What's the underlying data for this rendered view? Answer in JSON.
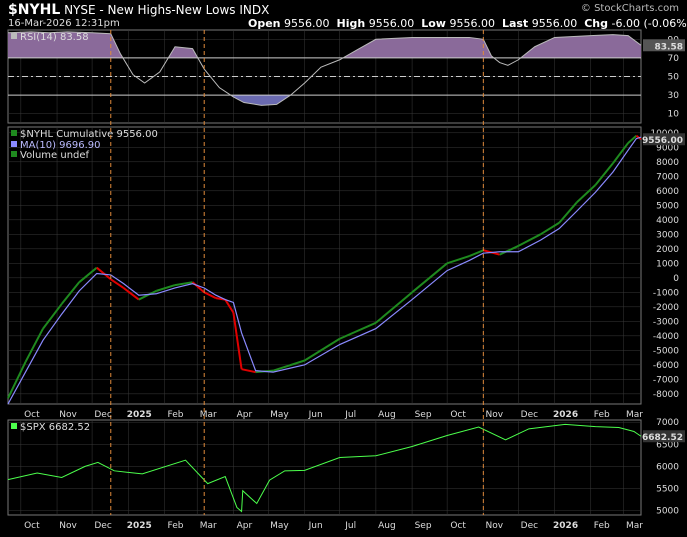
{
  "header": {
    "symbol": "$NYHL",
    "name": "NYSE - New Highs-New Lows",
    "exchange": "INDX",
    "date": "16-Mar-2026 12:31pm",
    "open_label": "Open",
    "open": "9556.00",
    "high_label": "High",
    "high": "9556.00",
    "low_label": "Low",
    "low": "9556.00",
    "last_label": "Last",
    "last": "9556.00",
    "chg_label": "Chg",
    "chg": "-6.00 (-0.06%)",
    "brand": "© StockCharts.com"
  },
  "colors": {
    "background": "#000000",
    "grid": "#3a3a3a",
    "up": "#1f8a1f",
    "down": "#e00000",
    "ma": "#8a8aff",
    "rsi_fill_high": "#8a6a9a",
    "rsi_fill_low": "#6a6ab0",
    "spx": "#4cff4c",
    "marker": "#e08a3a"
  },
  "chart_data": [
    {
      "type": "area",
      "panel": "rsi",
      "legend": "RSI(14) 83.58",
      "last_value_badge": "83.58",
      "ylim": [
        0,
        100
      ],
      "yticks": [
        10,
        30,
        50,
        70,
        90
      ],
      "ref_lines": [
        30,
        50,
        70
      ],
      "x": [
        "2024-09-20",
        "2024-10-10",
        "2024-10-25",
        "2024-11-10",
        "2024-12-01",
        "2024-12-17",
        "2024-12-25",
        "2025-01-05",
        "2025-01-15",
        "2025-01-28",
        "2025-02-10",
        "2025-02-25",
        "2025-03-07",
        "2025-03-20",
        "2025-04-01",
        "2025-04-10",
        "2025-04-25",
        "2025-05-08",
        "2025-05-20",
        "2025-06-01",
        "2025-06-15",
        "2025-07-01",
        "2025-07-15",
        "2025-08-01",
        "2025-09-01",
        "2025-10-01",
        "2025-10-20",
        "2025-11-01",
        "2025-11-08",
        "2025-11-15",
        "2025-11-22",
        "2025-12-01",
        "2025-12-15",
        "2026-01-01",
        "2026-02-01",
        "2026-02-20",
        "2026-03-05",
        "2026-03-16"
      ],
      "values": [
        97,
        98,
        97,
        98,
        97,
        96,
        75,
        52,
        43,
        55,
        82,
        80,
        58,
        38,
        28,
        22,
        19,
        20,
        30,
        43,
        60,
        68,
        78,
        90,
        92,
        92,
        92,
        90,
        72,
        65,
        62,
        68,
        82,
        92,
        94,
        95,
        94,
        83.58
      ]
    },
    {
      "type": "line",
      "panel": "main",
      "legend": [
        "$NYHL Cumulative 9556.00",
        "MA(10) 9696.90",
        "Volume undef"
      ],
      "last_value_badge": "9556.00",
      "ylim": [
        -8700,
        10400
      ],
      "yticks": [
        -8000,
        -7000,
        -6000,
        -5000,
        -4000,
        -3000,
        -2000,
        -1000,
        0,
        1000,
        2000,
        3000,
        4000,
        5000,
        6000,
        7000,
        8000,
        9000,
        10000
      ],
      "xticks": [
        "Oct",
        "Nov",
        "Dec",
        "2025",
        "Feb",
        "Mar",
        "Apr",
        "May",
        "Jun",
        "Jul",
        "Aug",
        "Sep",
        "Oct",
        "Nov",
        "Dec",
        "2026",
        "Feb",
        "Mar"
      ],
      "markers": [
        "2024-12-17",
        "2025-03-07",
        "2025-11-01"
      ],
      "series": [
        {
          "name": "$NYHL Cumulative",
          "x": [
            "2024-09-20",
            "2024-10-05",
            "2024-10-20",
            "2024-11-05",
            "2024-11-20",
            "2024-12-05",
            "2024-12-17",
            "2024-12-28",
            "2025-01-10",
            "2025-01-25",
            "2025-02-10",
            "2025-02-25",
            "2025-03-07",
            "2025-03-17",
            "2025-03-25",
            "2025-04-01",
            "2025-04-08",
            "2025-04-20",
            "2025-05-05",
            "2025-06-01",
            "2025-07-01",
            "2025-08-01",
            "2025-09-01",
            "2025-10-01",
            "2025-10-20",
            "2025-11-01",
            "2025-11-15",
            "2025-12-01",
            "2025-12-20",
            "2026-01-05",
            "2026-01-20",
            "2026-02-05",
            "2026-02-20",
            "2026-03-05",
            "2026-03-12",
            "2026-03-16"
          ],
          "values": [
            -8300,
            -5800,
            -3500,
            -1800,
            -300,
            700,
            -100,
            -700,
            -1500,
            -900,
            -500,
            -300,
            -1000,
            -1400,
            -1500,
            -2400,
            -6300,
            -6500,
            -6400,
            -5700,
            -4200,
            -3100,
            -1000,
            1000,
            1500,
            1900,
            1600,
            2200,
            3000,
            3800,
            5200,
            6400,
            7900,
            9300,
            9800,
            9556
          ]
        },
        {
          "name": "MA(10)",
          "x": [
            "2024-09-20",
            "2024-10-05",
            "2024-10-20",
            "2024-11-05",
            "2024-11-20",
            "2024-12-05",
            "2024-12-17",
            "2024-12-28",
            "2025-01-10",
            "2025-01-25",
            "2025-02-10",
            "2025-02-25",
            "2025-03-07",
            "2025-03-17",
            "2025-03-25",
            "2025-04-01",
            "2025-04-08",
            "2025-04-20",
            "2025-05-05",
            "2025-06-01",
            "2025-07-01",
            "2025-08-01",
            "2025-09-01",
            "2025-10-01",
            "2025-10-20",
            "2025-11-01",
            "2025-11-15",
            "2025-12-01",
            "2025-12-20",
            "2026-01-05",
            "2026-01-20",
            "2026-02-05",
            "2026-02-20",
            "2026-03-05",
            "2026-03-12",
            "2026-03-16"
          ],
          "values": [
            -8700,
            -6500,
            -4300,
            -2500,
            -900,
            300,
            200,
            -400,
            -1200,
            -1100,
            -700,
            -400,
            -700,
            -1200,
            -1500,
            -1700,
            -3800,
            -6400,
            -6500,
            -6000,
            -4600,
            -3500,
            -1500,
            500,
            1200,
            1700,
            1800,
            1800,
            2600,
            3400,
            4600,
            5900,
            7300,
            8800,
            9600,
            9697
          ]
        }
      ]
    },
    {
      "type": "line",
      "panel": "spx",
      "legend": "$SPX 6682.52",
      "last_value_badge": "6682.52",
      "ylim": [
        4900,
        7050
      ],
      "yticks": [
        5000,
        5500,
        6000,
        6500,
        7000
      ],
      "xticks": [
        "Oct",
        "Nov",
        "Dec",
        "2025",
        "Feb",
        "Mar",
        "Apr",
        "May",
        "Jun",
        "Jul",
        "Aug",
        "Sep",
        "Oct",
        "Nov",
        "Dec",
        "2026",
        "Feb",
        "Mar"
      ],
      "series": [
        {
          "name": "$SPX",
          "x": [
            "2024-09-20",
            "2024-10-15",
            "2024-11-05",
            "2024-11-25",
            "2024-12-06",
            "2024-12-20",
            "2025-01-13",
            "2025-02-19",
            "2025-03-10",
            "2025-03-25",
            "2025-04-04",
            "2025-04-08",
            "2025-04-09",
            "2025-04-21",
            "2025-05-02",
            "2025-05-15",
            "2025-06-01",
            "2025-07-01",
            "2025-08-01",
            "2025-09-01",
            "2025-10-01",
            "2025-10-28",
            "2025-11-20",
            "2025-12-10",
            "2026-01-10",
            "2026-02-05",
            "2026-02-25",
            "2026-03-10",
            "2026-03-16"
          ],
          "values": [
            5700,
            5850,
            5750,
            6000,
            6090,
            5900,
            5830,
            6140,
            5610,
            5770,
            5070,
            4980,
            5450,
            5160,
            5690,
            5900,
            5910,
            6200,
            6240,
            6450,
            6700,
            6890,
            6600,
            6850,
            6950,
            6900,
            6880,
            6790,
            6682.52
          ]
        }
      ]
    }
  ]
}
